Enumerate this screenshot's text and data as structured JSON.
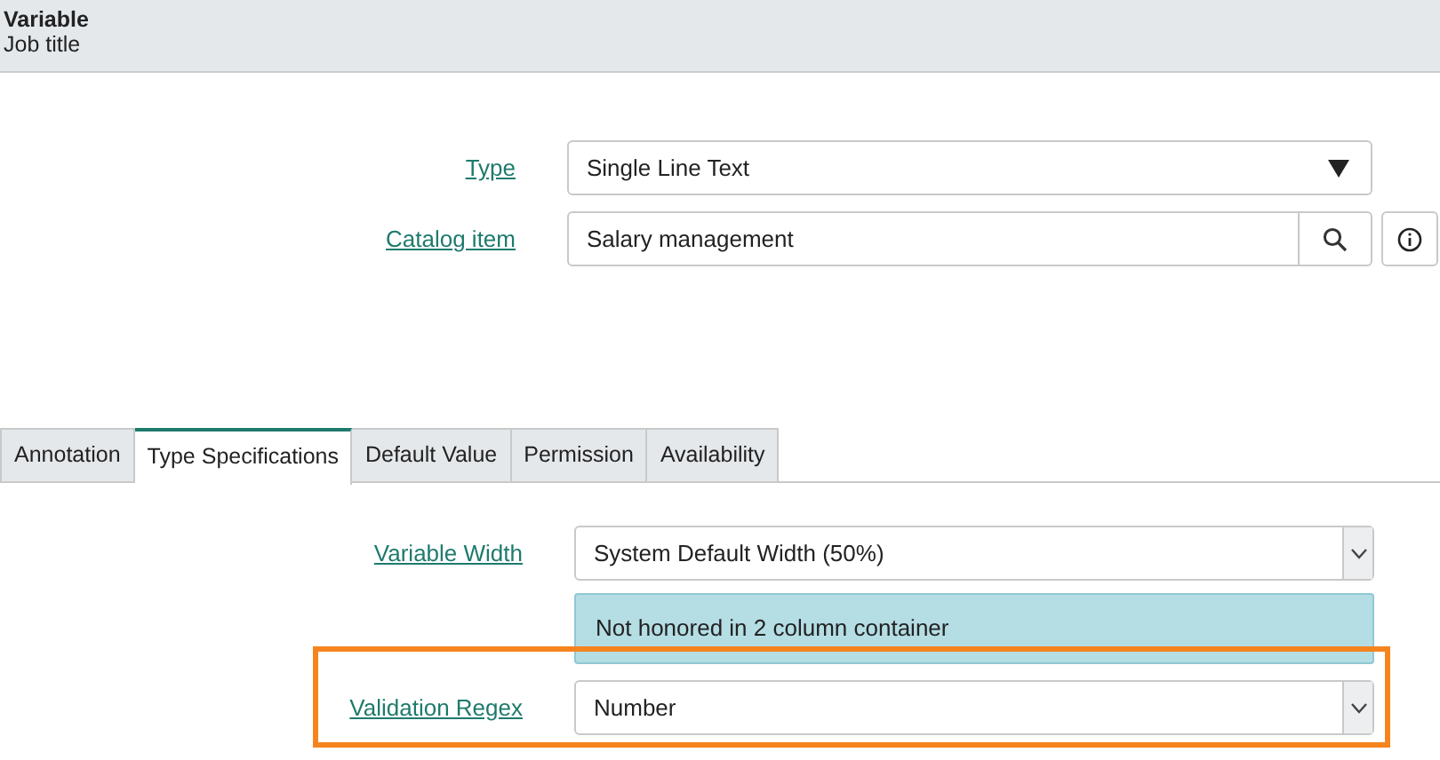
{
  "header": {
    "title": "Variable",
    "subtitle": "Job title"
  },
  "top_fields": [
    {
      "label": "Type",
      "kind": "select",
      "value": "Single Line Text"
    },
    {
      "label": "Catalog item",
      "kind": "reference",
      "value": "Salary management"
    }
  ],
  "tabs": [
    {
      "label": "Annotation",
      "selected": false
    },
    {
      "label": "Type Specifications",
      "selected": true
    },
    {
      "label": "Default Value",
      "selected": false
    },
    {
      "label": "Permission",
      "selected": false
    },
    {
      "label": "Availability",
      "selected": false
    }
  ],
  "spec_fields": [
    {
      "label": "Variable Width",
      "value": "System Default Width (50%)",
      "note": "Not honored in 2 column container",
      "highlighted": false
    },
    {
      "label": "Validation Regex",
      "value": "Number",
      "highlighted": true
    }
  ]
}
